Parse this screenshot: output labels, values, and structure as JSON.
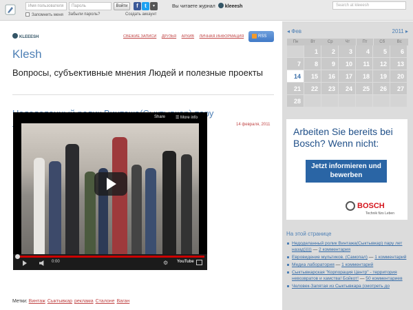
{
  "topbar": {
    "username_placeholder": "Имя пользователя",
    "password_placeholder": "Пароль",
    "login_label": "Войти",
    "remember_label": "Запомнить меня",
    "forgot_label": "Забыли пароль?",
    "create_label": "Создать аккаунт",
    "reading_label": "Вы читаете журнал",
    "reading_user": "kleeesh",
    "search_placeholder": "Search at kleeesh"
  },
  "journal": {
    "username": "KLEEESH",
    "nav": [
      "СВЕЖИЕ ЗАПИСИ",
      "ДРУЗЬЯ",
      "АРХИВ",
      "ЛИЧНАЯ ИНФОРМАЦИЯ"
    ],
    "rss_label": "RSS",
    "title": "Klesh",
    "subtitle": "Вопросы, субъективные мнения Людей и полезные проекты"
  },
  "post": {
    "title": "Недоделанный ролик Винтажа(Сыктывкар) пару лет назад)))))",
    "date": "14 февраля, 2011",
    "video": {
      "share_label": "Share",
      "more_label": "More info",
      "time": "0:00",
      "brand": "YouTube",
      "progress": 0
    },
    "tags_label": "Метки:",
    "tags": [
      "Винтаж",
      "Сыктывкар",
      "реклама",
      "Сталоне",
      "Ваган"
    ]
  },
  "calendar": {
    "month": "Фев",
    "year": "2011",
    "dow": [
      "Пн",
      "Вт",
      "Ср",
      "Чт",
      "Пт",
      "Сб",
      "Вс"
    ],
    "rows": [
      [
        "",
        "1",
        "2",
        "3",
        "4",
        "5",
        "6"
      ],
      [
        "7",
        "8",
        "9",
        "10",
        "11",
        "12",
        "13"
      ],
      [
        "14",
        "15",
        "16",
        "17",
        "18",
        "19",
        "20"
      ],
      [
        "21",
        "22",
        "23",
        "24",
        "25",
        "26",
        "27"
      ],
      [
        "28",
        "",
        "",
        "",
        "",
        "",
        ""
      ]
    ],
    "today": "14"
  },
  "ad": {
    "headline": "Arbeiten Sie bereits bei Bosch? Wenn nicht:",
    "button": "Jetzt informieren und bewerben",
    "logo": "BOSCH",
    "slogan": "Technik fürs Leben"
  },
  "on_page": {
    "title": "На этой странице",
    "items": [
      {
        "link": "Недоделанный ролик Винтажа(Сыктывкар) пару лет назад)))))",
        "comments": "2 комментария"
      },
      {
        "link": "Евровидение мультиков. (Самопал)",
        "comments": "1 комментарий"
      },
      {
        "link": "Медиа лаборатория",
        "comments": "1 комментарий"
      },
      {
        "link": "Сыктывкарская \"Корпорация Центр\" - территория невозвратов и хамства! Бойкот!",
        "comments": "50 комментариев"
      },
      {
        "link": "Человек-Запятая из Сыктывкара (смотреть до",
        "comments": ""
      }
    ]
  },
  "colors": {
    "accent": "#4d7fb5",
    "nav_red": "#c04444",
    "sidebar_bg": "#dcdcdc"
  }
}
